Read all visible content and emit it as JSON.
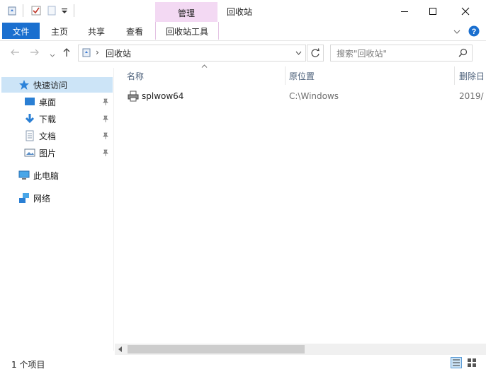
{
  "quick_access_toolbar": {
    "icons": [
      "recycle-bin-icon",
      "properties-icon",
      "new-folder-icon",
      "customize-arrow-icon"
    ]
  },
  "context_tab_group": {
    "label": "管理"
  },
  "window": {
    "title": "回收站"
  },
  "ribbon": {
    "file_tab": "文件",
    "tabs": [
      "主页",
      "共享",
      "查看"
    ],
    "context_tab": "回收站工具",
    "accent_color": "#1a6fcf",
    "context_color": "#f3d9f3"
  },
  "address_bar": {
    "path_separator": "›",
    "location": "回收站"
  },
  "search": {
    "placeholder": "搜索\"回收站\""
  },
  "sidebar": {
    "quick_access": "快速访问",
    "items": [
      {
        "label": "桌面",
        "icon": "desktop-icon",
        "pinned": true
      },
      {
        "label": "下载",
        "icon": "download-icon",
        "pinned": true
      },
      {
        "label": "文档",
        "icon": "document-icon",
        "pinned": true
      },
      {
        "label": "图片",
        "icon": "pictures-icon",
        "pinned": true
      }
    ],
    "this_pc": "此电脑",
    "network": "网络"
  },
  "columns": {
    "name": "名称",
    "original_location": "原位置",
    "date_deleted": "删除日"
  },
  "files": [
    {
      "name": "splwow64",
      "original_location": "C:\\Windows",
      "date_deleted": "2019/"
    }
  ],
  "status_bar": {
    "item_count": "1 个项目"
  }
}
